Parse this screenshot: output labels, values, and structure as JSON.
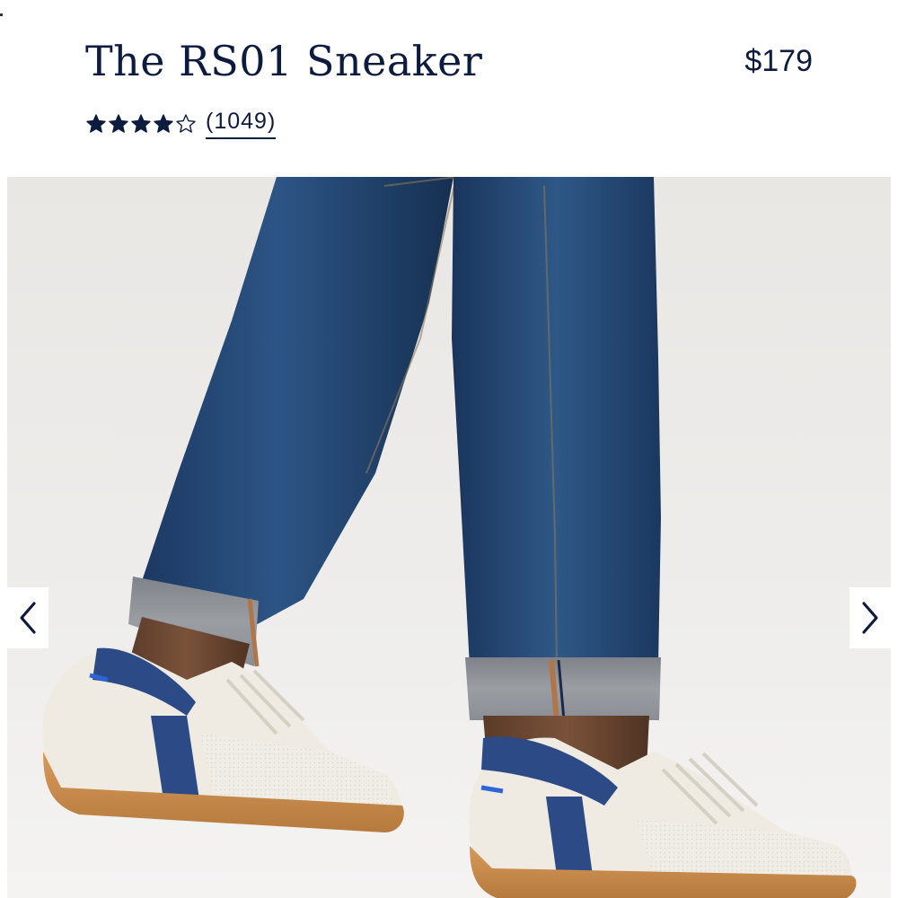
{
  "product": {
    "title": "The RS01 Sneaker",
    "price": "$179",
    "rating": {
      "stars_filled": 4,
      "stars_total": 5,
      "review_count_label": "(1049)"
    }
  },
  "gallery": {
    "prev_icon": "chevron-left-icon",
    "next_icon": "chevron-right-icon"
  },
  "colors": {
    "text": "#0d1b3e",
    "denim": "#1e3a66",
    "sneaker_navy": "#2b4a86",
    "gum_sole": "#c98b4c",
    "background": "#eceae7"
  }
}
